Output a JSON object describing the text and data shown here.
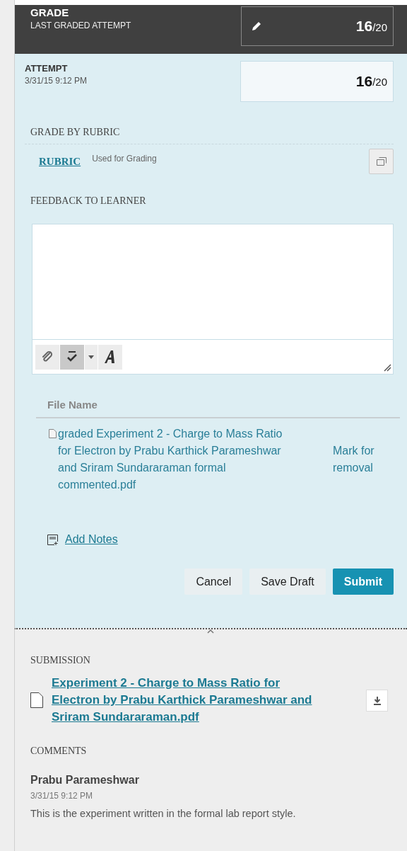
{
  "grade": {
    "title": "GRADE",
    "subtitle": "LAST GRADED ATTEMPT",
    "score": "16",
    "out_of": "/20"
  },
  "attempt": {
    "title": "ATTEMPT",
    "date": "3/31/15 9:12 PM",
    "score": "16",
    "out_of": "/20"
  },
  "rubric": {
    "heading": "GRADE BY RUBRIC",
    "link": "RUBRIC",
    "note": "Used for Grading"
  },
  "feedback": {
    "heading": "FEEDBACK TO LEARNER",
    "toolbar": [
      {
        "kind": "attach",
        "pressed": false
      },
      {
        "kind": "spellcheck",
        "pressed": true
      },
      {
        "kind": "dropdown",
        "pressed": false
      },
      {
        "kind": "font",
        "pressed": false
      }
    ]
  },
  "files": {
    "column": "File Name",
    "rows": [
      {
        "name": "graded Experiment 2 - Charge to Mass Ratio for Electron by Prabu Karthick Parameshwar and Sriram Sundararaman formal commented.pdf",
        "action": "Mark for removal"
      }
    ]
  },
  "add_notes": "Add Notes",
  "buttons": [
    {
      "label": "Cancel",
      "kind": "plain"
    },
    {
      "label": "Save Draft",
      "kind": "plain"
    },
    {
      "label": "Submit",
      "kind": "primary"
    }
  ],
  "submission": {
    "heading": "SUBMISSION",
    "file": "Experiment 2 - Charge to Mass Ratio for Electron by Prabu Karthick Parameshwar and Sriram Sundararaman.pdf"
  },
  "comments": {
    "heading": "COMMENTS",
    "items": [
      {
        "author": "Prabu Parameshwar",
        "date": "3/31/15 9:12 PM",
        "text": "This is the experiment written in the formal lab report style."
      }
    ]
  }
}
